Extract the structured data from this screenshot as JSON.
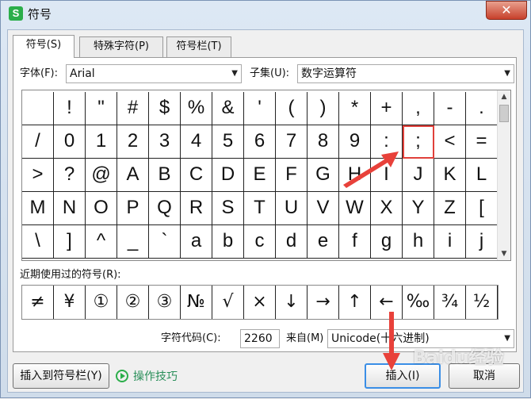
{
  "window": {
    "title": "符号",
    "app_icon_letter": "S",
    "close_symbol": "✕"
  },
  "tabs": [
    {
      "label": "符号(S)",
      "active": true
    },
    {
      "label": "特殊字符(P)",
      "active": false
    },
    {
      "label": "符号栏(T)",
      "active": false
    }
  ],
  "font": {
    "label": "字体(F):",
    "value": "Arial"
  },
  "subset": {
    "label": "子集(U):",
    "value": "数字运算符"
  },
  "symbol_grid": {
    "rows": [
      [
        "",
        "!",
        "\"",
        "#",
        "$",
        "%",
        "&",
        "'",
        "(",
        ")",
        "*",
        "+",
        ",",
        "-",
        "."
      ],
      [
        "/",
        "0",
        "1",
        "2",
        "3",
        "4",
        "5",
        "6",
        "7",
        "8",
        "9",
        ":",
        ";",
        "<",
        "="
      ],
      [
        ">",
        "?",
        "@",
        "A",
        "B",
        "C",
        "D",
        "E",
        "F",
        "G",
        "H",
        "I",
        "J",
        "K",
        "L"
      ],
      [
        "M",
        "N",
        "O",
        "P",
        "Q",
        "R",
        "S",
        "T",
        "U",
        "V",
        "W",
        "X",
        "Y",
        "Z",
        "["
      ],
      [
        "\\",
        "]",
        "^",
        "_",
        "`",
        "a",
        "b",
        "c",
        "d",
        "e",
        "f",
        "g",
        "h",
        "i",
        "j"
      ]
    ],
    "selected": {
      "row": 1,
      "col": 12
    }
  },
  "recent": {
    "label": "近期使用过的符号(R):",
    "symbols": [
      "≠",
      "¥",
      "①",
      "②",
      "③",
      "№",
      "√",
      "×",
      "↓",
      "→",
      "↑",
      "←",
      "‰",
      "¾",
      "½"
    ]
  },
  "char_code": {
    "label": "字符代码(C):",
    "value": "2260"
  },
  "from": {
    "label": "来自(M)",
    "value": "Unicode(十六进制)"
  },
  "buttons": {
    "insert_to_bar": "插入到符号栏(Y)",
    "tips": "操作技巧",
    "insert": "插入(I)",
    "cancel": "取消"
  },
  "watermark": "Baidu经验",
  "colors": {
    "annotation": "#e8413a",
    "accent": "#3a8ee6",
    "brand": "#2bae4a"
  }
}
